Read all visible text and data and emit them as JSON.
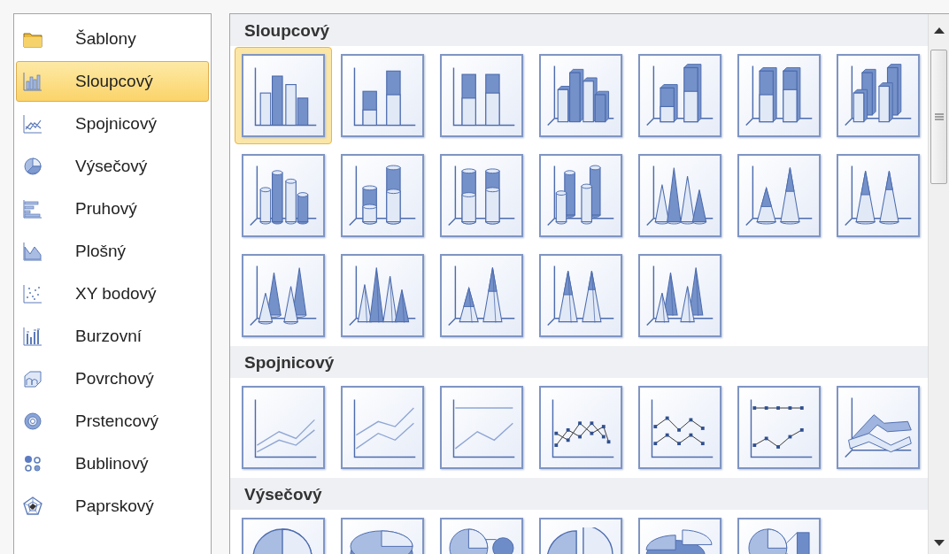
{
  "sidebar": {
    "items": [
      {
        "label": "Šablony",
        "selected": false
      },
      {
        "label": "Sloupcový",
        "selected": true
      },
      {
        "label": "Spojnicový",
        "selected": false
      },
      {
        "label": "Výsečový",
        "selected": false
      },
      {
        "label": "Pruhový",
        "selected": false
      },
      {
        "label": "Plošný",
        "selected": false
      },
      {
        "label": "XY bodový",
        "selected": false
      },
      {
        "label": "Burzovní",
        "selected": false
      },
      {
        "label": "Povrchový",
        "selected": false
      },
      {
        "label": "Prstencový",
        "selected": false
      },
      {
        "label": "Bublinový",
        "selected": false
      },
      {
        "label": "Paprskový",
        "selected": false
      }
    ]
  },
  "gallery": {
    "sections": [
      {
        "title": "Sloupcový",
        "items": [
          {
            "selected": true
          },
          {
            "selected": false
          },
          {
            "selected": false
          },
          {
            "selected": false
          },
          {
            "selected": false
          },
          {
            "selected": false
          },
          {
            "selected": false
          },
          {
            "selected": false
          },
          {
            "selected": false
          },
          {
            "selected": false
          },
          {
            "selected": false
          },
          {
            "selected": false
          },
          {
            "selected": false
          },
          {
            "selected": false
          },
          {
            "selected": false
          },
          {
            "selected": false
          },
          {
            "selected": false
          },
          {
            "selected": false
          },
          {
            "selected": false
          }
        ]
      },
      {
        "title": "Spojnicový",
        "items": [
          {
            "selected": false
          },
          {
            "selected": false
          },
          {
            "selected": false
          },
          {
            "selected": false
          },
          {
            "selected": false
          },
          {
            "selected": false
          },
          {
            "selected": false
          }
        ]
      },
      {
        "title": "Výsečový",
        "items": [
          {
            "selected": false
          },
          {
            "selected": false
          },
          {
            "selected": false
          },
          {
            "selected": false
          },
          {
            "selected": false
          },
          {
            "selected": false
          }
        ]
      }
    ]
  }
}
